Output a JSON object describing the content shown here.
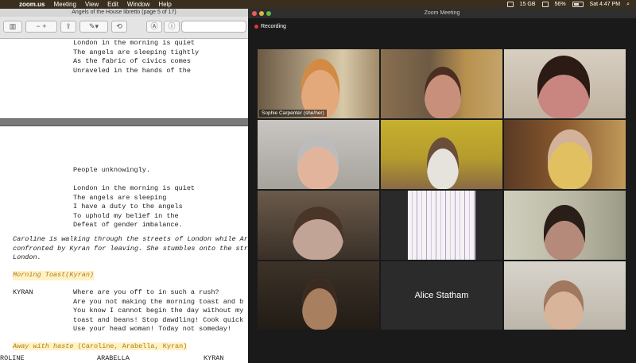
{
  "menubar": {
    "app": "zoom.us",
    "items": [
      "Meeting",
      "View",
      "Edit",
      "Window",
      "Help"
    ],
    "status": {
      "gb": "15 GB",
      "battery": "56%",
      "time": "Sat 4:47 PM"
    }
  },
  "preview": {
    "title": "Angels of the House libretto (page 5 of 17)",
    "page1_lines": [
      "London in the morning is quiet",
      "The angels are sleeping tightly",
      "As the fabric of civics comes",
      "Unraveled in the hands of the"
    ],
    "page2": {
      "verse_lines": [
        "People unknowingly.",
        "",
        "London in the morning is quiet",
        "The angels are sleeping",
        "I have a duty to the angels",
        "To uphold my belief in the",
        "Defeat of gender imbalance."
      ],
      "stage_direction": [
        "Caroline is walking through the streets of London while Arabell",
        "confronted by Kyran for leaving. She stumbles onto the streets",
        "London."
      ],
      "song1": "Morning Toast(Kyran)",
      "speaker": "KYRAN",
      "kyran_lines": [
        "Where are you off to in such a rush?",
        "Are you not making the morning toast and b",
        "You know I cannot begin the day without my",
        "toast and beans! Stop dawdling! Cook quick",
        "Use your head woman! Today not someday!"
      ],
      "song2_hl": "Away with haste",
      "song2_rest": " (Caroline, Arabella, Kyran)",
      "columns": [
        "ROLINE",
        "ARABELLA",
        "KYRAN"
      ]
    }
  },
  "zoom": {
    "title": "Zoom Meeting",
    "recording": "Recording",
    "active_speaker": "Sophie Carpenter (she/her)",
    "no_video_name": "Alice Statham"
  },
  "colors": {
    "active_border": "#e6e06a",
    "record": "#e6362e"
  }
}
